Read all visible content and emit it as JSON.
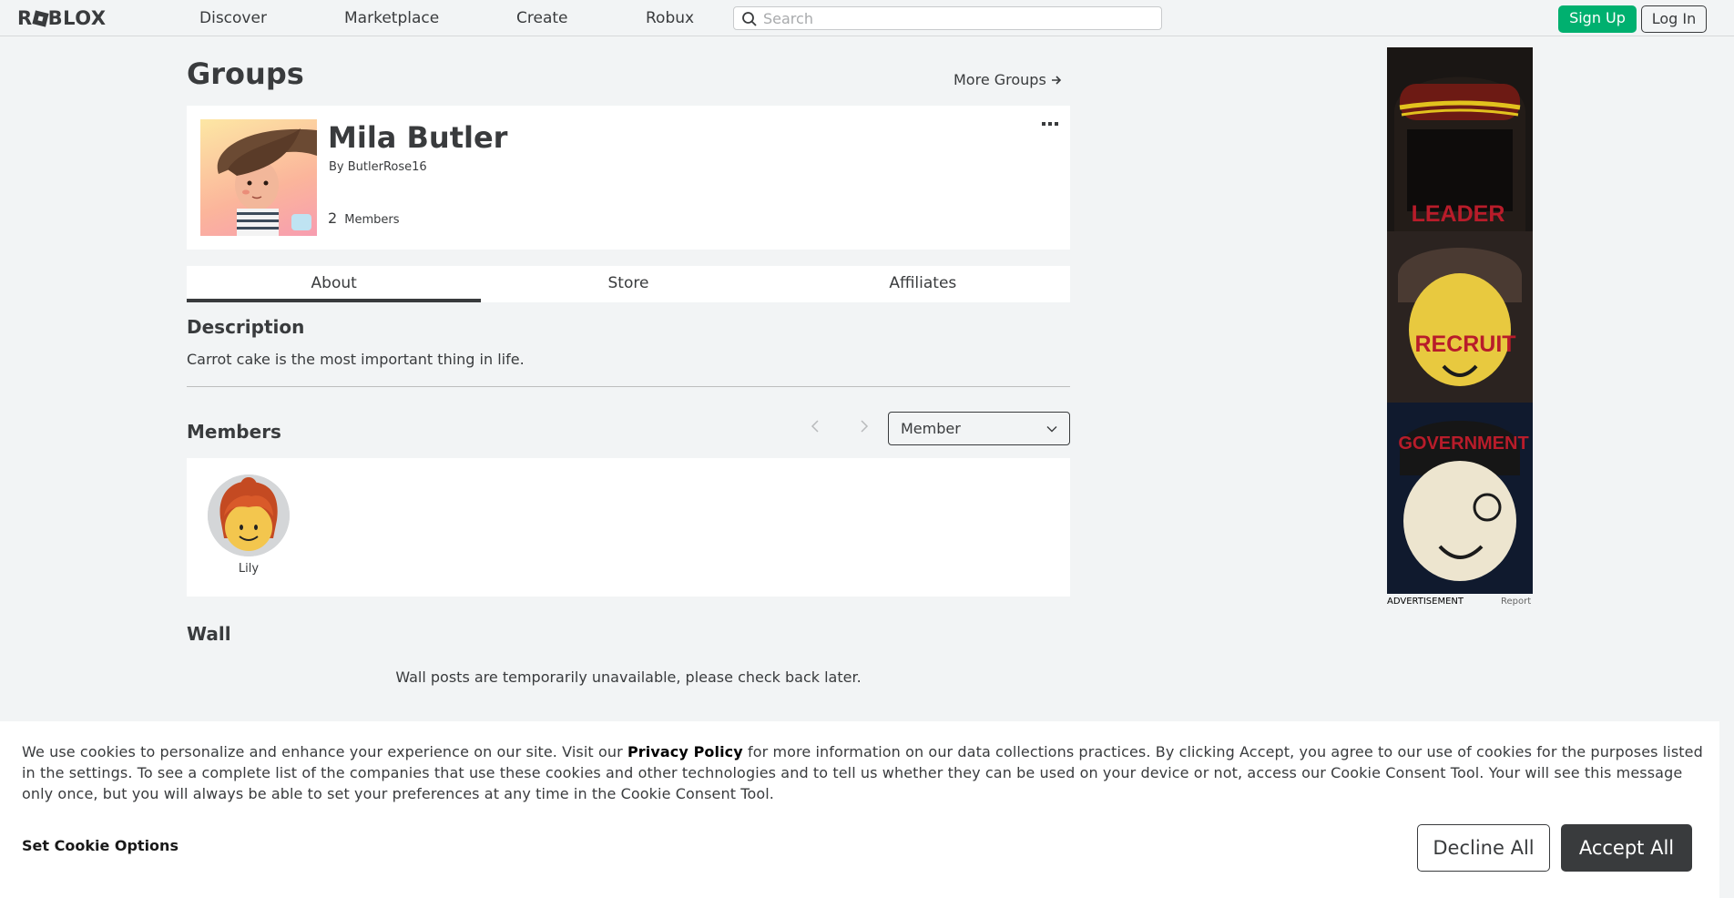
{
  "nav": {
    "logo": "ROBLOX",
    "links": [
      "Discover",
      "Marketplace",
      "Create",
      "Robux"
    ],
    "search_placeholder": "Search",
    "signup_label": "Sign Up",
    "login_label": "Log In"
  },
  "header": {
    "title": "Groups",
    "more_groups": "More Groups"
  },
  "group": {
    "name": "Mila Butler",
    "by_prefix": "By",
    "owner": "ButlerRose16",
    "member_count": "2",
    "member_label": "Members"
  },
  "tabs": [
    {
      "label": "About",
      "active": true
    },
    {
      "label": "Store",
      "active": false
    },
    {
      "label": "Affiliates",
      "active": false
    }
  ],
  "description": {
    "heading": "Description",
    "text": "Carrot cake is the most important thing in life."
  },
  "members": {
    "heading": "Members",
    "role_selected": "Member",
    "list": [
      {
        "name": "Lily"
      }
    ]
  },
  "wall": {
    "heading": "Wall",
    "message": "Wall posts are temporarily unavailable, please check back later."
  },
  "ad": {
    "ranks": [
      "LEADER",
      "RECRUIT",
      "GOVERNMENT"
    ],
    "label": "ADVERTISEMENT",
    "report": "Report"
  },
  "cookie": {
    "text_before": "We use cookies to personalize and enhance your experience on our site. Visit our ",
    "policy_link": "Privacy Policy",
    "text_after": " for more information on our data collections practices. By clicking Accept, you agree to our use of cookies for the purposes listed in the settings. To see a complete list of the companies that use these cookies and other technologies and to tell us whether they can be used on your device or not, access our Cookie Consent Tool. Your will see this message only once, but you will always be able to set your preferences at any time in the Cookie Consent Tool.",
    "set_options": "Set Cookie Options",
    "decline": "Decline All",
    "accept": "Accept All"
  },
  "colors": {
    "accent_green": "#00b06f",
    "text_dark": "#393b3d",
    "page_bg": "#f2f4f5"
  }
}
